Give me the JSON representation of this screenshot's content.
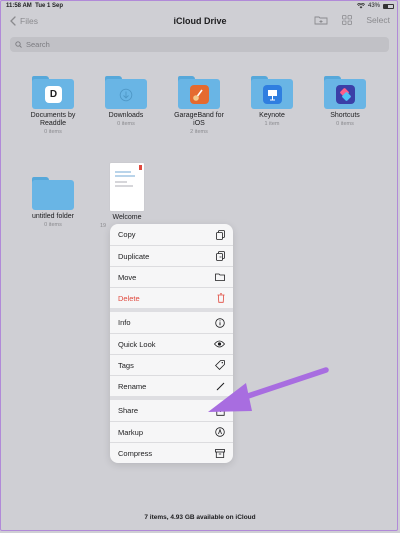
{
  "status": {
    "time": "11:58 AM",
    "date": "Tue 1 Sep",
    "battery": "43%",
    "battery_level": 0.43
  },
  "nav": {
    "back_label": "Files",
    "title": "iCloud Drive",
    "select_label": "Select"
  },
  "search": {
    "placeholder": "Search"
  },
  "items": [
    {
      "name_line1": "Documents by",
      "name_line2": "Readdle",
      "sub": "0 items",
      "badge": "D",
      "badge_color": "#1c1c1e"
    },
    {
      "name_line1": "Downloads",
      "name_line2": "",
      "sub": "0 items",
      "badge": "",
      "badge_color": ""
    },
    {
      "name_line1": "GarageBand for",
      "name_line2": "iOS",
      "sub": "2 items",
      "badge": "",
      "badge_color": "#e56a2f"
    },
    {
      "name_line1": "Keynote",
      "name_line2": "",
      "sub": "1 item",
      "badge": "",
      "badge_color": "#2f7ee0"
    },
    {
      "name_line1": "Shortcuts",
      "name_line2": "",
      "sub": "0 items",
      "badge": "",
      "badge_color": "#3b3fa8"
    },
    {
      "name_line1": "untitled folder",
      "name_line2": "",
      "sub": "0 items"
    }
  ],
  "document": {
    "name": "Welcome",
    "sub_partial": "19"
  },
  "menu": {
    "copy": "Copy",
    "duplicate": "Duplicate",
    "move": "Move",
    "delete": "Delete",
    "info": "Info",
    "quick_look": "Quick Look",
    "tags": "Tags",
    "rename": "Rename",
    "share": "Share",
    "markup": "Markup",
    "compress": "Compress"
  },
  "footer": {
    "summary": "7 items, 4.93 GB available on iCloud"
  },
  "colors": {
    "accent": "#8a8a8e",
    "destructive": "#e0493e",
    "folder": "#69b5e5",
    "annotation_arrow": "#a86de0"
  }
}
